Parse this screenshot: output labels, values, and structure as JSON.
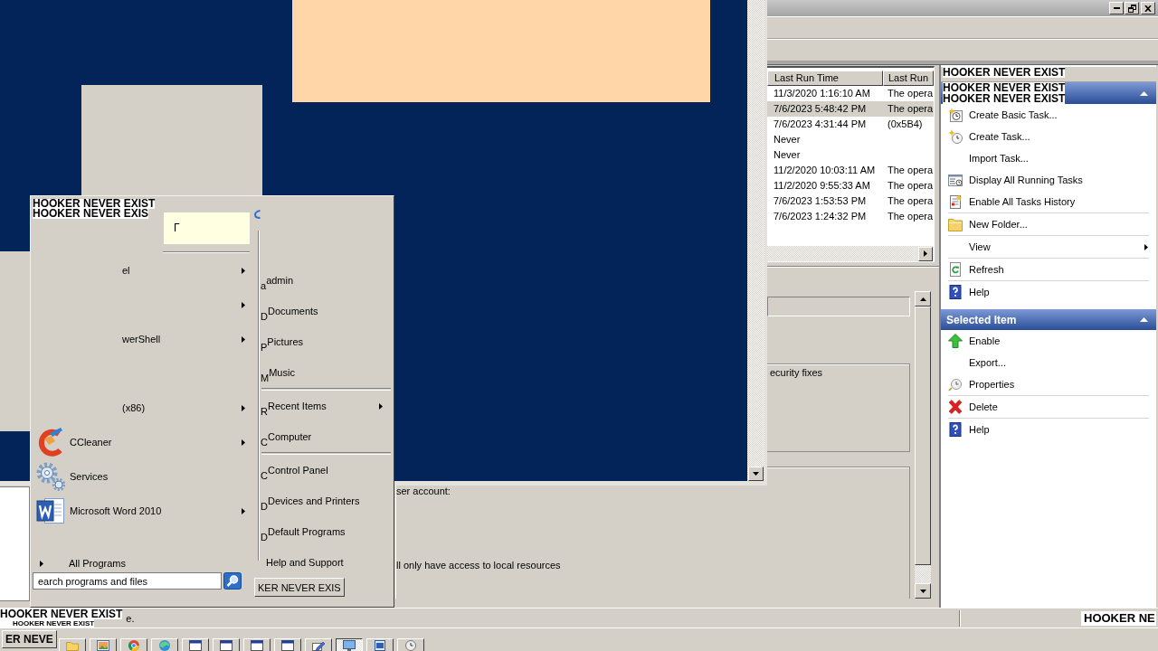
{
  "task_scheduler": {
    "task_list": {
      "columns": [
        "Last Run Time",
        "Last Run"
      ],
      "rows": [
        {
          "cells": [
            "11/3/2020 1:16:10 AM",
            "The opera"
          ],
          "selected": false
        },
        {
          "cells": [
            "7/6/2023 5:48:42 PM",
            "The opera"
          ],
          "selected": true
        },
        {
          "cells": [
            "7/6/2023 4:31:44 PM",
            "(0x5B4)"
          ],
          "selected": false
        },
        {
          "cells": [
            "Never"
          ],
          "selected": false
        },
        {
          "cells": [
            "Never"
          ],
          "selected": false
        },
        {
          "cells": [
            "11/2/2020 10:03:11 AM",
            "The opera"
          ],
          "selected": false
        },
        {
          "cells": [
            "11/2/2020 9:55:33 AM",
            "The opera"
          ],
          "selected": false
        },
        {
          "cells": [
            "7/6/2023 1:53:53 PM",
            "The opera"
          ],
          "selected": false
        },
        {
          "cells": [
            "7/6/2023 1:24:32 PM",
            "The opera"
          ],
          "selected": false
        }
      ]
    },
    "details": {
      "security_note": "ecurity fixes",
      "account_label": "ser account:",
      "access_note": "ll only have access to local resources"
    },
    "actions": {
      "overlay_line": "HOOKER NEVER EXIST",
      "sections": [
        {
          "header_lines": [
            "HOOKER NEVER EXIST",
            "HOOKER NEVER EXIST"
          ],
          "groups": [
            [
              {
                "label": "Create Basic Task...",
                "kind": "wizard"
              },
              {
                "label": "Create Task...",
                "kind": "task"
              },
              {
                "label": "Import Task...",
                "kind": "plain"
              },
              {
                "label": "Display All Running Tasks",
                "kind": "running"
              },
              {
                "label": "Enable All Tasks History",
                "kind": "history"
              }
            ],
            [
              {
                "label": "New Folder...",
                "kind": "folder"
              }
            ],
            [
              {
                "label": "View",
                "kind": "submenu"
              }
            ],
            [
              {
                "label": "Refresh",
                "kind": "refresh"
              }
            ],
            [
              {
                "label": "Help",
                "kind": "help"
              }
            ]
          ]
        },
        {
          "title": "Selected Item",
          "groups": [
            [
              {
                "label": "Enable",
                "kind": "enable"
              },
              {
                "label": "Export...",
                "kind": "plain"
              },
              {
                "label": "Properties",
                "kind": "properties"
              }
            ],
            [
              {
                "label": "Delete",
                "kind": "delete"
              }
            ],
            [
              {
                "label": "Help",
                "kind": "help"
              }
            ]
          ]
        }
      ]
    },
    "status_bar": {
      "overlay_lines": [
        "HOOKER NEVER EXIST",
        "HOOKER NEVER EXIST"
      ],
      "text": "e.",
      "right_text": "HOOKER NE"
    }
  },
  "start_menu": {
    "overlay_lines": [
      "HOOKER NEVER EXIST",
      "HOOKER NEVER EXIS"
    ],
    "tooltip": "Γ",
    "program_groups": [
      [
        {
          "label": "el",
          "kind": "plain",
          "submenu": true
        },
        {
          "kind": "plain",
          "submenu": true
        },
        {
          "label": "werShell",
          "kind": "plain",
          "submenu": true
        }
      ],
      [
        {
          "label": "(x86)",
          "kind": "plain",
          "submenu": true
        },
        {
          "label": "CCleaner",
          "kind": "ccleaner",
          "submenu": true
        },
        {
          "label": "Services",
          "kind": "services",
          "submenu": false
        },
        {
          "label": "Microsoft Word 2010",
          "kind": "word",
          "submenu": true
        }
      ]
    ],
    "all_programs": "All Programs",
    "search": {
      "placeholder": "earch programs and files"
    },
    "place_groups": [
      [
        {
          "initial": "a",
          "label": "admin",
          "submenu": false
        },
        {
          "initial": "D",
          "label": "Documents",
          "submenu": false
        },
        {
          "initial": "P",
          "label": "Pictures",
          "submenu": false
        },
        {
          "initial": "M",
          "label": "Music",
          "submenu": false
        }
      ],
      [
        {
          "initial": "R",
          "label": "Recent Items",
          "submenu": true
        },
        {
          "initial": "C",
          "label": "Computer",
          "submenu": false
        }
      ],
      [
        {
          "initial": "C",
          "label": "Control Panel",
          "submenu": false
        },
        {
          "initial": "D",
          "label": "Devices and Printers",
          "submenu": false
        },
        {
          "initial": "D",
          "label": "Default Programs",
          "submenu": false
        },
        {
          "label": "Help and Support",
          "submenu": false
        }
      ]
    ],
    "power_button": "KER NEVER EXIS"
  },
  "taskbar": {
    "start_button": "ER NEVE",
    "buttons": [
      {
        "kind": "folder",
        "selected": false
      },
      {
        "kind": "picture",
        "selected": false
      },
      {
        "kind": "ring",
        "selected": false
      },
      {
        "kind": "circle",
        "selected": false
      },
      {
        "kind": "window",
        "selected": false
      },
      {
        "kind": "window",
        "selected": false
      },
      {
        "kind": "window",
        "selected": false
      },
      {
        "kind": "window",
        "selected": false
      },
      {
        "kind": "pen",
        "selected": false
      },
      {
        "kind": "monitor",
        "selected": true
      },
      {
        "kind": "document",
        "selected": false
      },
      {
        "kind": "clock",
        "selected": false
      }
    ]
  }
}
